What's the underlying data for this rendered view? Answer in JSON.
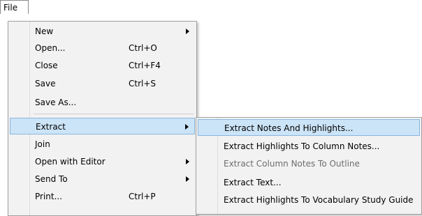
{
  "menubar": {
    "file_label": "File"
  },
  "file_menu": {
    "items": [
      {
        "label": "New",
        "shortcut": ""
      },
      {
        "label": "Open...",
        "shortcut": "Ctrl+O"
      },
      {
        "label": "Close",
        "shortcut": "Ctrl+F4"
      },
      {
        "label": "Save",
        "shortcut": "Ctrl+S"
      },
      {
        "label": "Save As...",
        "shortcut": ""
      },
      {
        "label": "Extract",
        "shortcut": ""
      },
      {
        "label": "Join",
        "shortcut": ""
      },
      {
        "label": "Open with Editor",
        "shortcut": ""
      },
      {
        "label": "Send To",
        "shortcut": ""
      },
      {
        "label": "Print...",
        "shortcut": "Ctrl+P"
      }
    ]
  },
  "extract_submenu": {
    "items": [
      {
        "label": "Extract Notes And Highlights..."
      },
      {
        "label": "Extract Highlights To Column Notes..."
      },
      {
        "label": "Extract Column Notes To Outline"
      },
      {
        "label": "Extract Text..."
      },
      {
        "label": "Extract Highlights To Vocabulary Study Guide"
      }
    ]
  },
  "colors": {
    "highlight_fill": "#cce4f7",
    "highlight_border": "#8ab6e0",
    "menu_background": "#f2f2f2",
    "disabled_text": "#6d6d6d"
  },
  "icons": {
    "submenu_arrow": "chevron-right-icon"
  }
}
